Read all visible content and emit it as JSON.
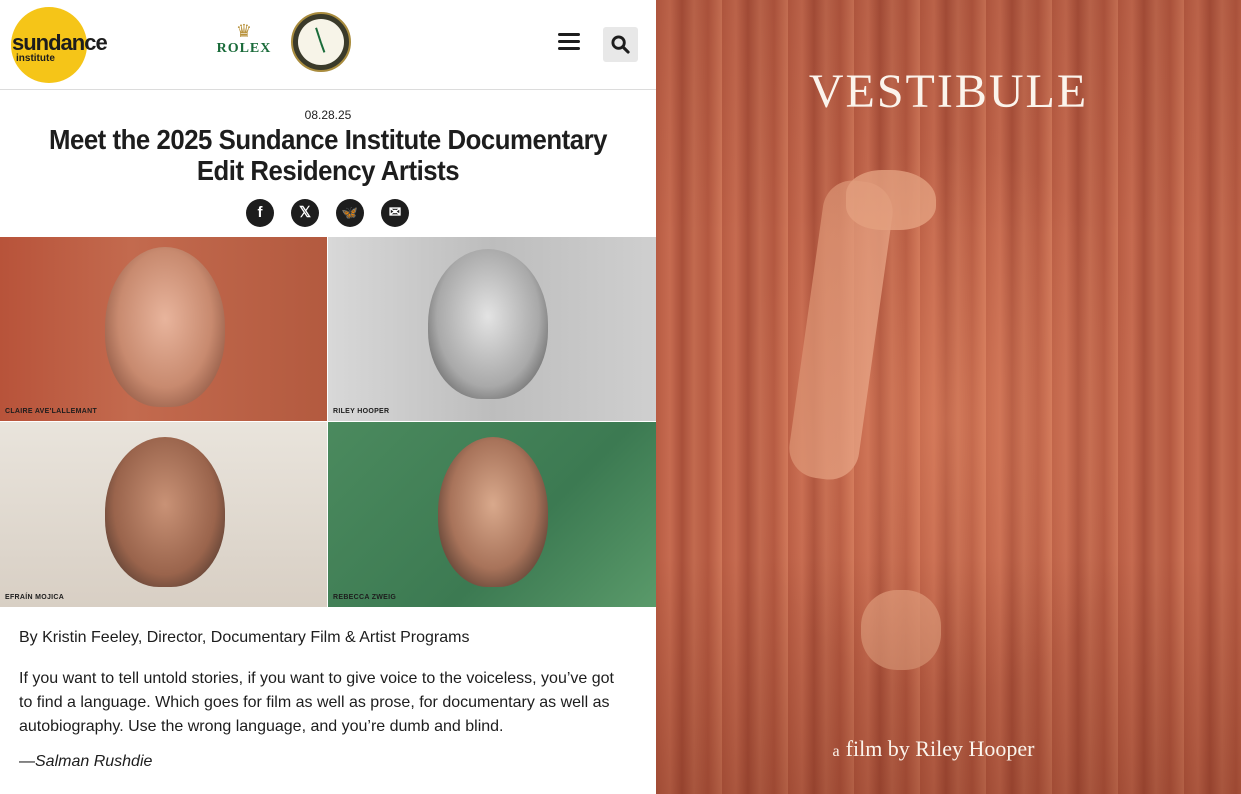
{
  "header": {
    "logo_main": "sundance",
    "logo_sub": "institute",
    "sponsor": "ROLEX",
    "menu_icon": "hamburger-menu-icon",
    "search_icon": "search-icon"
  },
  "article": {
    "date": "08.28.25",
    "title": "Meet the 2025 Sundance Institute Documentary Edit Residency Artists",
    "share": [
      {
        "name": "facebook",
        "glyph": "f"
      },
      {
        "name": "x",
        "glyph": "𝕏"
      },
      {
        "name": "bluesky",
        "glyph": "🦋"
      },
      {
        "name": "email",
        "glyph": "✉"
      }
    ],
    "photos": [
      {
        "caption": "CLAIRE AVE'LALLEMANT"
      },
      {
        "caption": "RILEY HOOPER"
      },
      {
        "caption": "EFRAÍN MOJICA"
      },
      {
        "caption": "REBECCA ZWEIG"
      }
    ],
    "byline": "By Kristin Feeley, Director, Documentary Film & Artist Programs",
    "quote": "If you want to tell untold stories, if you want to give voice to the voiceless, you’ve got to find a language. Which goes for film as well as prose, for documentary as well as autobiography. Use the wrong language, and you’re dumb and blind.",
    "attribution_dash": "—",
    "attribution_name": "Salman Rushdie"
  },
  "poster": {
    "title": "VESTIBULE",
    "credit_a": "a",
    "credit": "film by Riley Hooper"
  },
  "colors": {
    "logo_yellow": "#f5c518",
    "rolex_green": "#1a6b3a",
    "poster_red": "#b85c43"
  }
}
